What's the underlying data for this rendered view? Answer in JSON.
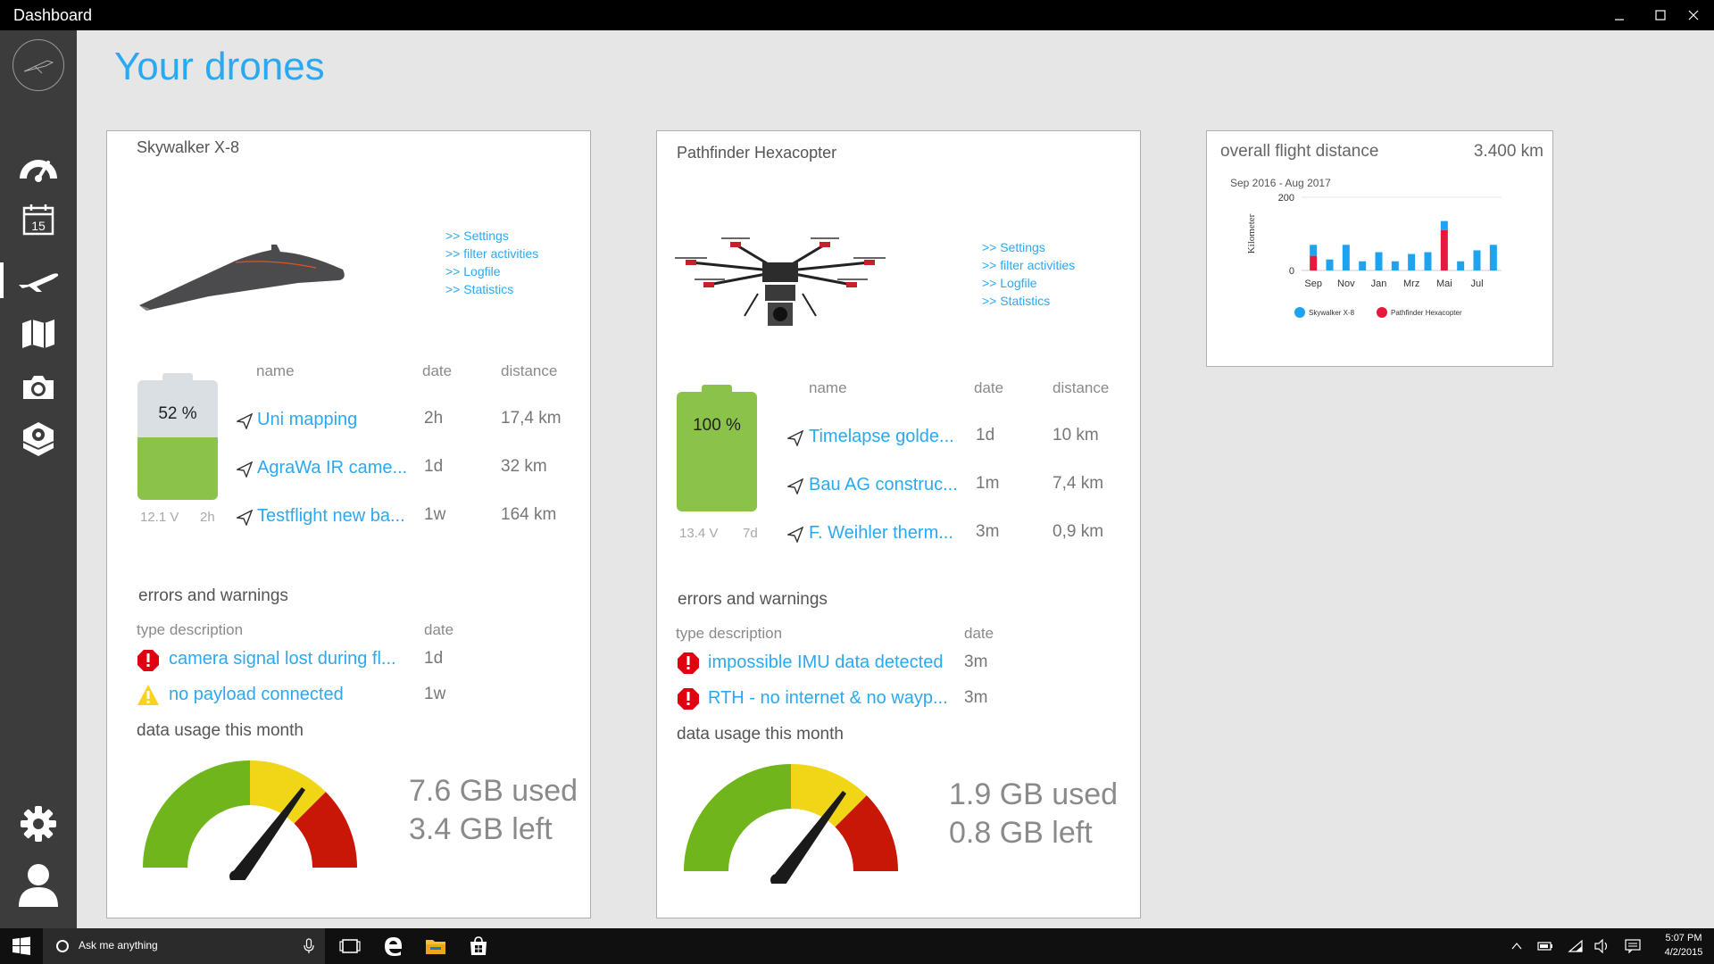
{
  "window": {
    "title": "Dashboard"
  },
  "page": {
    "title": "Your drones"
  },
  "sidebar": {
    "items": [
      {
        "name": "speedometer-icon"
      },
      {
        "name": "calendar-icon",
        "label": "15"
      },
      {
        "name": "airplane-icon",
        "active": true
      },
      {
        "name": "map-icon"
      },
      {
        "name": "camera-icon"
      },
      {
        "name": "drone-box-icon"
      }
    ],
    "bottom": [
      {
        "name": "gear-icon"
      },
      {
        "name": "user-icon"
      }
    ]
  },
  "drones": [
    {
      "name": "Skywalker X-8",
      "links": [
        ">> Settings",
        ">> filter activities",
        ">> Logfile",
        ">> Statistics"
      ],
      "battery": {
        "percent_label": "52 %",
        "level": 0.52,
        "voltage": "12.1 V",
        "time": "2h"
      },
      "activities_headers": {
        "name": "name",
        "date": "date",
        "distance": "distance"
      },
      "activities": [
        {
          "name": "Uni mapping",
          "date": "2h",
          "distance": "17,4 km"
        },
        {
          "name": "AgraWa IR came...",
          "date": "1d",
          "distance": "32 km"
        },
        {
          "name": "Testflight new ba...",
          "date": "1w",
          "distance": "164 km"
        }
      ],
      "errors_title": "errors and warnings",
      "errors_headers": {
        "type": "type description",
        "date": "date"
      },
      "errors": [
        {
          "level": "error",
          "text": "camera signal lost during fl...",
          "date": "1d"
        },
        {
          "level": "warning",
          "text": "no payload connected",
          "date": "1w"
        }
      ],
      "data_title": "data usage this month",
      "data_used": "7.6 GB used",
      "data_left": "3.4 GB left",
      "gauge_fraction": 0.69
    },
    {
      "name": "Pathfinder Hexacopter",
      "links": [
        ">> Settings",
        ">> filter activities",
        ">> Logfile",
        ">> Statistics"
      ],
      "battery": {
        "percent_label": "100 %",
        "level": 1.0,
        "voltage": "13.4 V",
        "time": "7d"
      },
      "activities_headers": {
        "name": "name",
        "date": "date",
        "distance": "distance"
      },
      "activities": [
        {
          "name": "Timelapse golde...",
          "date": "1d",
          "distance": "10 km"
        },
        {
          "name": "Bau AG construc...",
          "date": "1m",
          "distance": "7,4 km"
        },
        {
          "name": "F. Weihler therm...",
          "date": "3m",
          "distance": "0,9 km"
        }
      ],
      "errors_title": "errors and warnings",
      "errors_headers": {
        "type": "type description",
        "date": "date"
      },
      "errors": [
        {
          "level": "error",
          "text": "impossible IMU data detected",
          "date": "3m"
        },
        {
          "level": "error",
          "text": "RTH - no internet & no wayp...",
          "date": "3m"
        }
      ],
      "data_title": "data usage this month",
      "data_used": "1.9 GB used",
      "data_left": "0.8 GB left",
      "gauge_fraction": 0.69
    }
  ],
  "stats": {
    "title": "overall flight distance",
    "total": "3.400 km",
    "colors": {
      "skywalker": "#1ea3f0",
      "pathfinder": "#e8173c"
    },
    "chart_data": {
      "type": "bar",
      "subtitle": "Sep 2016 - Aug 2017",
      "ylabel": "Kilometer",
      "ylim": [
        0,
        200
      ],
      "y_ticks": [
        "200",
        "0"
      ],
      "x_tick_labels": [
        "Sep",
        "Nov",
        "Jan",
        "Mrz",
        "Mai",
        "Jul"
      ],
      "categories": [
        "Sep",
        "Okt",
        "Nov",
        "Dez",
        "Jan",
        "Feb",
        "Mrz",
        "Apr",
        "Mai",
        "Jun",
        "Jul",
        "Aug"
      ],
      "stacked": true,
      "series": [
        {
          "name": "Skywalker X-8",
          "color": "#1ea3f0",
          "values": [
            30,
            30,
            70,
            25,
            50,
            25,
            45,
            50,
            25,
            25,
            55,
            70
          ]
        },
        {
          "name": "Pathfinder Hexacopter",
          "color": "#e8173c",
          "values": [
            40,
            0,
            0,
            0,
            0,
            0,
            0,
            0,
            110,
            0,
            0,
            0
          ]
        }
      ],
      "legend": [
        "Skywalker X-8",
        "Pathfinder Hexacopter"
      ],
      "legend_position": "bottom"
    }
  },
  "taskbar": {
    "search_placeholder": "Ask me anything",
    "time": "5:07 PM",
    "date": "4/2/2015"
  }
}
